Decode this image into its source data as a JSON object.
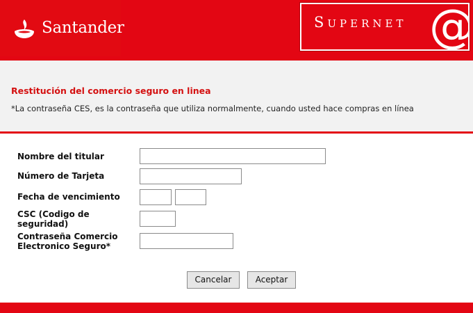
{
  "header": {
    "brand": "Santander",
    "product": "Supernet",
    "product_symbol": "@",
    "icons": [
      "santander-flame-icon",
      "at-sign-icon"
    ]
  },
  "main": {
    "title": "Restitución del comercio seguro en linea",
    "note": "*La contraseña CES, es la contraseña que utiliza normalmente, cuando usted hace compras en línea"
  },
  "form": {
    "holder_name_label": "Nombre del titular",
    "card_number_label": "Número de Tarjeta",
    "expiry_label": "Fecha de vencimiento",
    "csc_label_line1": "CSC (Codigo de",
    "csc_label_line2": "seguridad)",
    "ces_label_line1": "Contraseña Comercio",
    "ces_label_line2": "Electronico Seguro*",
    "holder_name_value": "",
    "card_number_value": "",
    "expiry_month_value": "",
    "expiry_year_value": "",
    "csc_value": "",
    "ces_value": ""
  },
  "buttons": {
    "cancel": "Cancelar",
    "accept": "Aceptar"
  },
  "colors": {
    "brand_red": "#e30613",
    "title_red": "#d41010",
    "gray_panel": "#f2f2f2",
    "button_gray": "#e6e6e6"
  }
}
